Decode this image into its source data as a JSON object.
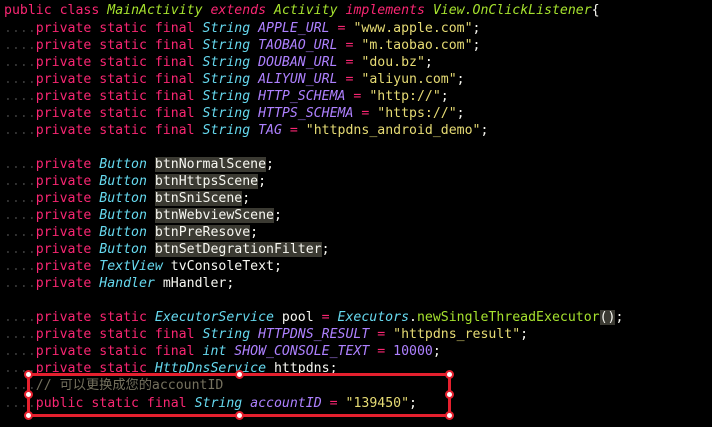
{
  "code": {
    "line1": {
      "kw1": "public",
      "kw2": "class",
      "name": "MainActivity",
      "kw3": "extends",
      "parent": "Activity",
      "kw4": "implements",
      "iface": "View.OnClickListener",
      "brace": "{"
    },
    "consts": [
      {
        "mods": "private static final",
        "type": "String",
        "name": "APPLE_URL",
        "eq": "=",
        "value": "\"www.apple.com\"",
        "end": ";"
      },
      {
        "mods": "private static final",
        "type": "String",
        "name": "TAOBAO_URL",
        "eq": "=",
        "value": "\"m.taobao.com\"",
        "end": ";"
      },
      {
        "mods": "private static final",
        "type": "String",
        "name": "DOUBAN_URL",
        "eq": "=",
        "value": "\"dou.bz\"",
        "end": ";"
      },
      {
        "mods": "private static final",
        "type": "String",
        "name": "ALIYUN_URL",
        "eq": "=",
        "value": "\"aliyun.com\"",
        "end": ";"
      },
      {
        "mods": "private static final",
        "type": "String",
        "name": "HTTP_SCHEMA",
        "eq": "=",
        "value": "\"http://\"",
        "end": ";"
      },
      {
        "mods": "private static final",
        "type": "String",
        "name": "HTTPS_SCHEMA",
        "eq": "=",
        "value": "\"https://\"",
        "end": ";"
      },
      {
        "mods": "private static final",
        "type": "String",
        "name": "TAG",
        "eq": "=",
        "value": "\"httpdns_android_demo\"",
        "end": ";"
      }
    ],
    "fields": [
      {
        "mod": "private",
        "type": "Button",
        "name": "btnNormalScene",
        "end": ";"
      },
      {
        "mod": "private",
        "type": "Button",
        "name": "btnHttpsScene",
        "end": ";"
      },
      {
        "mod": "private",
        "type": "Button",
        "name": "btnSniScene",
        "end": ";"
      },
      {
        "mod": "private",
        "type": "Button",
        "name": "btnWebviewScene",
        "end": ";"
      },
      {
        "mod": "private",
        "type": "Button",
        "name": "btnPreResove",
        "end": ";"
      },
      {
        "mod": "private",
        "type": "Button",
        "name": "btnSetDegrationFilter",
        "end": ";"
      },
      {
        "mod": "private",
        "type": "TextView",
        "name": "tvConsoleText",
        "end": ";"
      },
      {
        "mod": "private",
        "type": "Handler",
        "name": "mHandler",
        "end": ";"
      }
    ],
    "pool": {
      "mods": "private static",
      "type": "ExecutorService",
      "name": "pool",
      "eq": "=",
      "cls": "Executors",
      "dot": ".",
      "method": "newSingleThreadExecutor",
      "call": "()",
      "end": ";"
    },
    "result": {
      "mods": "private static final",
      "type": "String",
      "name": "HTTPDNS_RESULT",
      "eq": "=",
      "value": "\"httpdns_result\"",
      "end": ";"
    },
    "show": {
      "mods": "private static final",
      "type": "int",
      "name": "SHOW_CONSOLE_TEXT",
      "eq": "=",
      "value": "10000",
      "end": ";"
    },
    "service": {
      "mods": "private static",
      "type": "HttpDnsService",
      "name": "httpdns",
      "end": ";"
    },
    "comment": "// 可以更换成您的accountID",
    "account": {
      "mods": "public static final",
      "type": "String",
      "name": "accountID",
      "eq": "=",
      "value": "\"139450\"",
      "end": ";"
    }
  },
  "colors": {
    "background": "#000000",
    "annotation": "#e5202e"
  }
}
